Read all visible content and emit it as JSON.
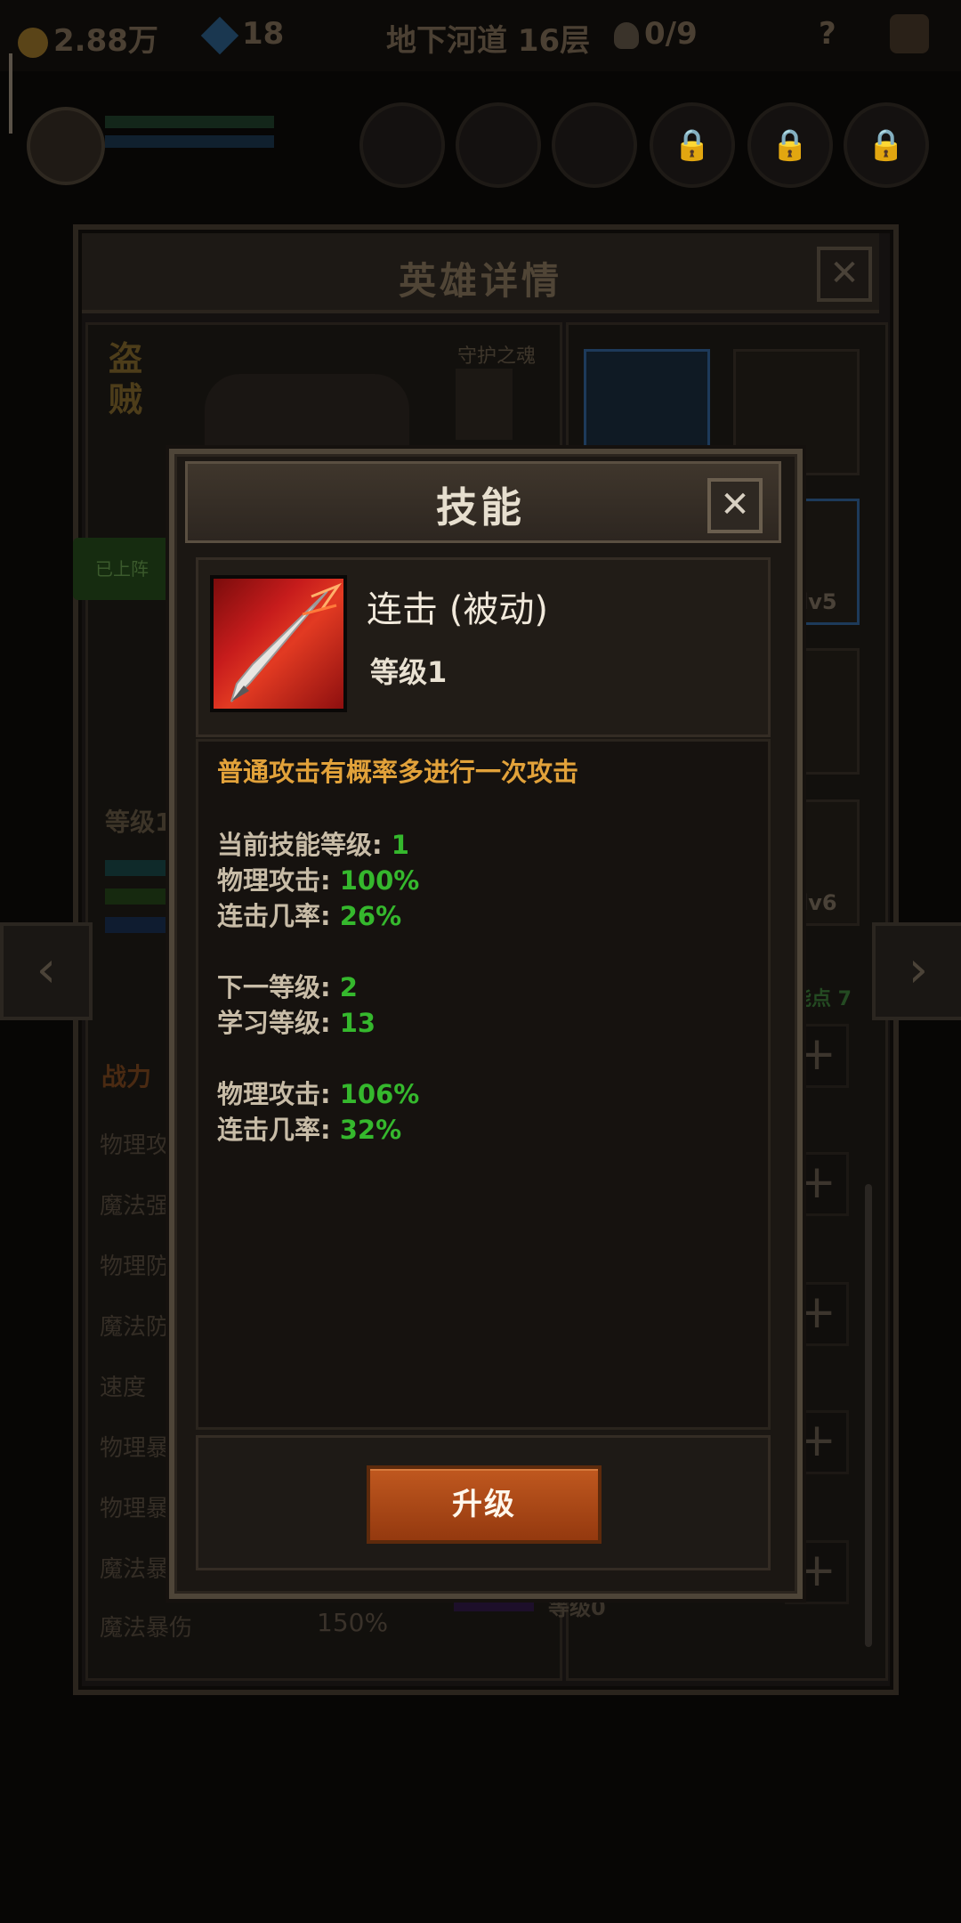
{
  "topbar": {
    "gold": "2.88万",
    "gems": "18",
    "location": "地下河道 16层",
    "keys": "0/9",
    "help": "?"
  },
  "hero_panel": {
    "title": "英雄详情",
    "close": "✕",
    "class_name": "盗贼",
    "guard_label": "守护之魂",
    "deployed_badge": "已上阵",
    "level": "等级1",
    "power_label": "战力",
    "stats": [
      "物理攻",
      "魔法强",
      "物理防",
      "魔法防",
      "速度",
      "物理暴",
      "物理暴",
      "魔法暴",
      "魔法暴伤"
    ],
    "crit_damage_value": "150%",
    "equip_levels": [
      "lv5",
      "lv6"
    ],
    "skill_points": "能点 7",
    "skill_row_level": "等级0",
    "prev_arrow": "‹",
    "next_arrow": "›"
  },
  "modal": {
    "title": "技能",
    "close": "✕",
    "skill_name": "连击 (被动)",
    "skill_level": "等级1",
    "description": "普通攻击有概率多进行一次攻击",
    "current": {
      "level_label": "当前技能等级:",
      "level_value": "1",
      "atk_label": "物理攻击:",
      "atk_value": "100%",
      "combo_label": "连击几率:",
      "combo_value": "26%"
    },
    "next": {
      "level_label": "下一等级:",
      "level_value": "2",
      "learn_label": "学习等级:",
      "learn_value": "13",
      "atk_label": "物理攻击:",
      "atk_value": "106%",
      "combo_label": "连击几率:",
      "combo_value": "32%"
    },
    "upgrade_label": "升级"
  },
  "colors": {
    "accent_orange": "#e2a23a",
    "value_green": "#35b82d",
    "button_orange": "#c0581f"
  }
}
